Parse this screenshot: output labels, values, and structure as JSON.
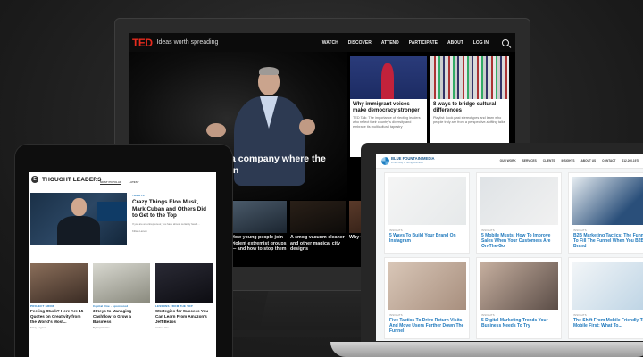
{
  "ted": {
    "logo": "TED",
    "tagline": "Ideas worth spreading",
    "menu": [
      "WATCH",
      "DISCOVER",
      "ATTEND",
      "PARTICIPATE",
      "ABOUT",
      "LOG IN"
    ],
    "hero_caption": "a company where the\nin",
    "side_cards": [
      {
        "title": "Why immigrant voices make democracy stronger",
        "sub": "TED Talk: The importance of electing leaders who reflect their country's diversity and embrace its multicultural tapestry"
      },
      {
        "title": "8 ways to bridge cultural differences",
        "sub": "Playlist: Look past stereotypes and learn who people truly are from a perspective-shifting talks"
      }
    ],
    "bottom_captions": [
      "How young people join violent extremist groups — and how to stop them",
      "A smog vacuum cleaner and other magical city designs",
      "Why the tre..."
    ]
  },
  "tablet": {
    "logo_letter": "E",
    "title": "THOUGHT LEADERS",
    "tabs": [
      "MOST POPULAR",
      "LATEST"
    ],
    "feature": {
      "category": "TWEETS",
      "title": "Crazy Things Elon Musk, Mark Cuban and Others Did to Get to the Top",
      "sub": "If you are an entrepreneur, you have almost certainly heard...",
      "meta": "Killian Larson"
    },
    "cards": [
      {
        "category": "PROJECT GRIND",
        "title": "Feeling Stuck? Here Are 15 Quotes on Creativity from the World's Most...",
        "meta": "Stacy Aagaard"
      },
      {
        "category": "Capital One  ·  sponsored",
        "title": "3 Keys to Managing Cashflow to Grow a Business",
        "meta": "By Capital One"
      },
      {
        "category": "LESSONS FROM THE TOP",
        "title": "Strategies for Success You Can Learn From Amazon's Jeff Bezos",
        "meta": "Andrea Hsu"
      }
    ]
  },
  "laptop": {
    "brand": "BLUE FOUNTAIN MEDIA",
    "brand_sub": "a new way of doing business",
    "menu": [
      "OUR WORK",
      "SERVICES",
      "CLIENTS",
      "INSIGHTS",
      "ABOUT US",
      "CONTACT",
      "212.260.1978"
    ],
    "cards": [
      {
        "category": "INSIGHTS",
        "title": "5 Ways To Build Your Brand On Instagram"
      },
      {
        "category": "INSIGHTS",
        "title": "5 Mobile Musts: How To Improve Sales When Your Customers Are On-The-Go"
      },
      {
        "category": "INSIGHTS",
        "title": "B2B Marketing Tactics: The Funnel To Fill The Funnel When You B2B Brand"
      },
      {
        "category": "INSIGHTS",
        "title": "Five Tactics To Drive Return Visits And Move Users Further Down The Funnel"
      },
      {
        "category": "INSIGHTS",
        "title": "5 Digital Marketing Trends Your Business Needs To Try"
      },
      {
        "category": "INSIGHTS",
        "title": "The Shift From Mobile Friendly To Mobile First: What To..."
      }
    ]
  },
  "colors": {
    "ted_red": "#e62b1e",
    "link_blue": "#1e78bc",
    "brand_blue": "#1d5a8e"
  }
}
